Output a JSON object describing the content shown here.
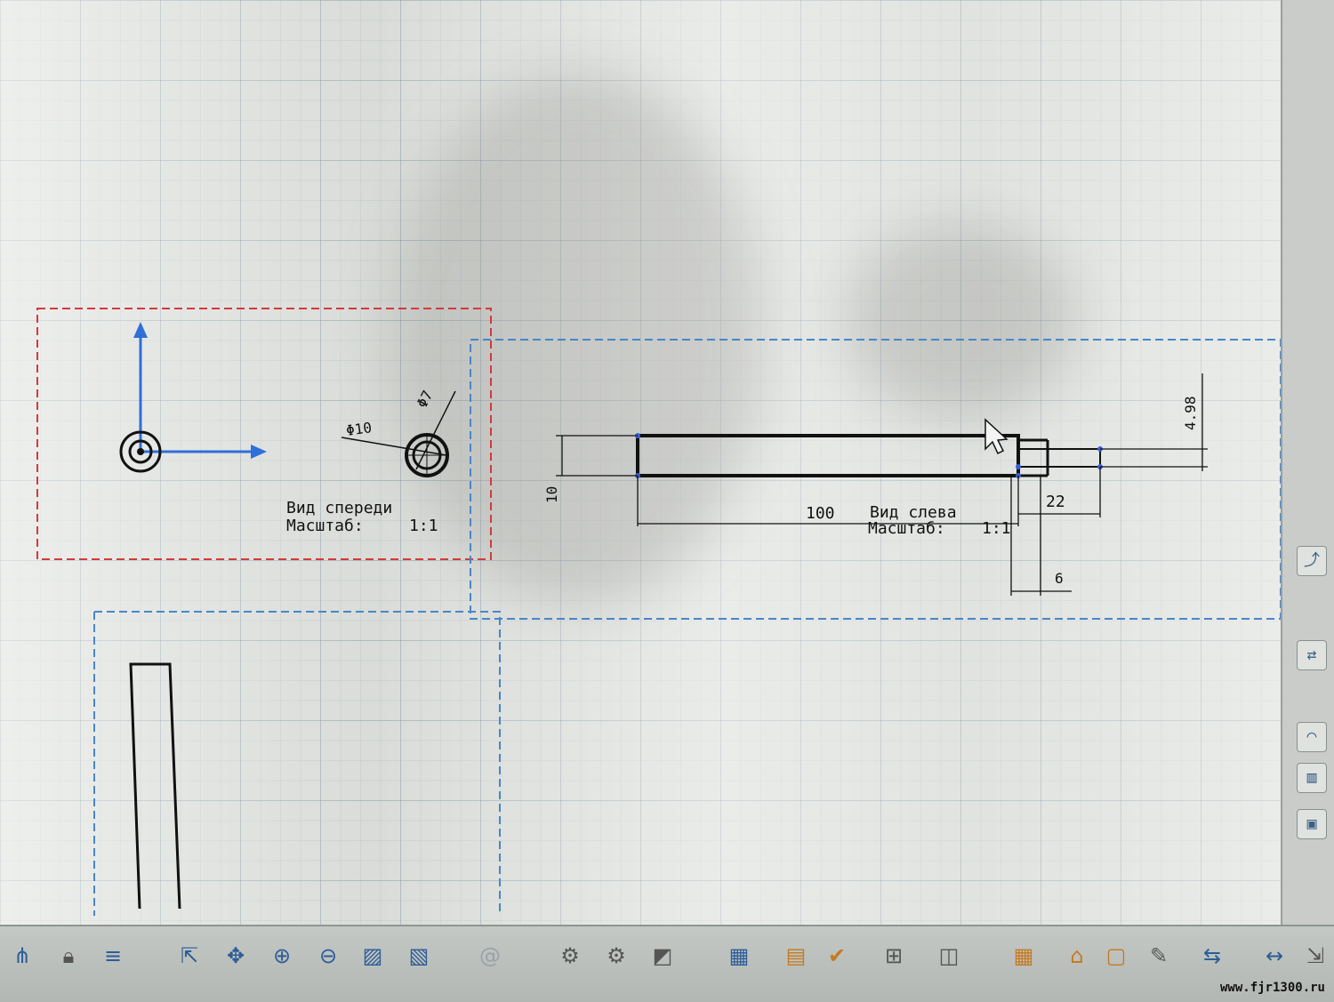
{
  "views": {
    "front": {
      "title": "Вид спереди",
      "scale_label": "Масштаб:",
      "scale_value": "1:1",
      "dim_outer": "Φ10",
      "dim_inner": "Φ7"
    },
    "left": {
      "title": "Вид слева",
      "scale_label": "Масштаб:",
      "scale_value": "1:1",
      "dim_length": "100",
      "dim_height": "10",
      "dim_tip_length": "22",
      "dim_step": "6",
      "dim_tip_offset": "4.98"
    }
  },
  "colors": {
    "front_view_frame": "#d23a3a",
    "left_view_frame": "#4a86c8",
    "axis": "#2f6fd8",
    "line": "#111111",
    "canvas": "#d9dcd8"
  },
  "right_panel": {
    "icons": [
      "curve-icon",
      "swap-arrows-icon",
      "arc-icon",
      "bars-icon",
      "view-box-icon"
    ]
  },
  "toolbar": {
    "icons": [
      "tree-icon",
      "lock-icon",
      "variables-icon",
      "pan-fit-icon",
      "move-icon",
      "zoom-in-icon",
      "zoom-out-icon",
      "zoom-area-icon",
      "zoom-window-icon",
      "spiral-icon",
      "settings-icon",
      "gears-icon",
      "render-icon",
      "grid-select-icon",
      "folder-icon",
      "check-icon",
      "dimension-icon",
      "layers-icon",
      "table-icon",
      "chair-icon",
      "frame-icon",
      "pin-icon",
      "transfer-icon",
      "width-icon",
      "export-icon"
    ]
  },
  "watermark": "www.fjr1300.ru"
}
